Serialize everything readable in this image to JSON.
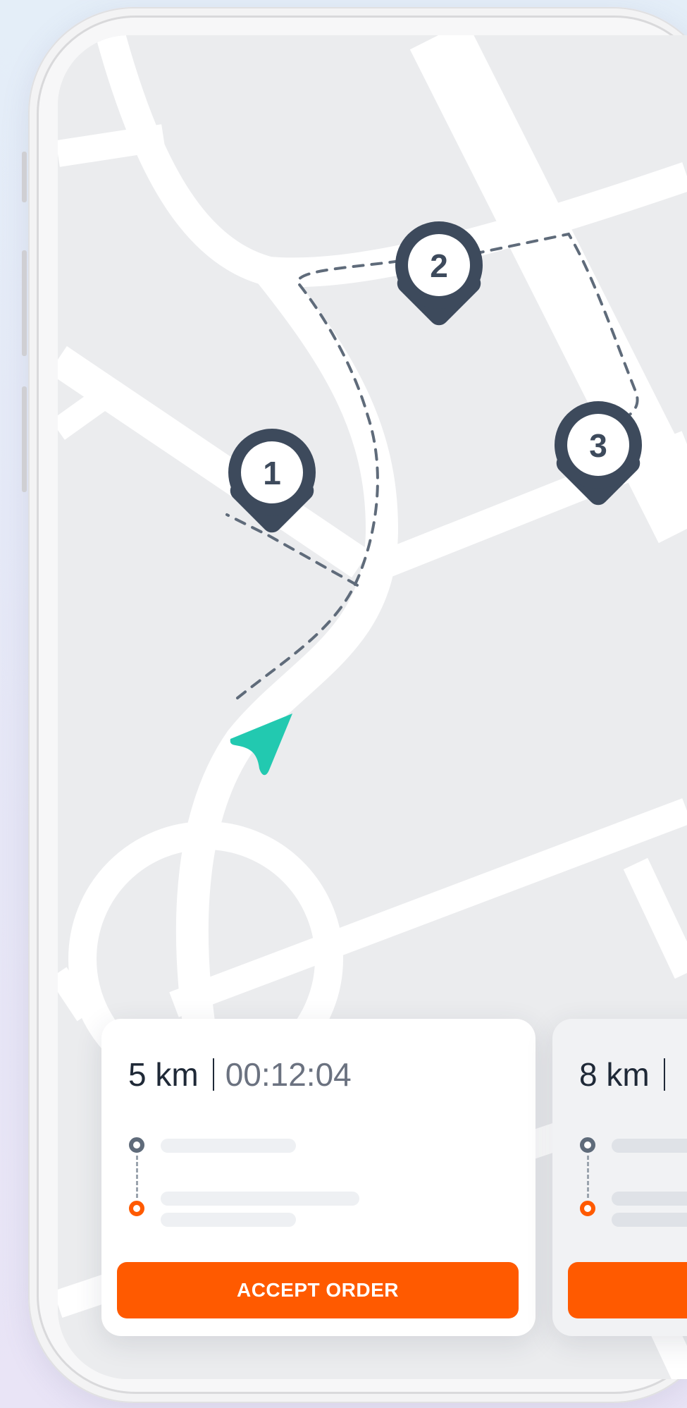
{
  "map": {
    "stops": [
      {
        "number": "1"
      },
      {
        "number": "2"
      },
      {
        "number": "3"
      }
    ],
    "colors": {
      "road": "#ffffff",
      "ground": "#ebecee",
      "pin": "#3d4a5c",
      "route": "#5f6b7a",
      "navigator": "#22c9b0"
    }
  },
  "orders": [
    {
      "distance": "5 km",
      "time": "00:12:04",
      "action_label": "ACCEPT ORDER"
    },
    {
      "distance": "8 km",
      "time": "",
      "action_label": ""
    }
  ],
  "colors": {
    "accent": "#ff5a00",
    "text": "#1f2937",
    "muted": "#6b7280"
  }
}
